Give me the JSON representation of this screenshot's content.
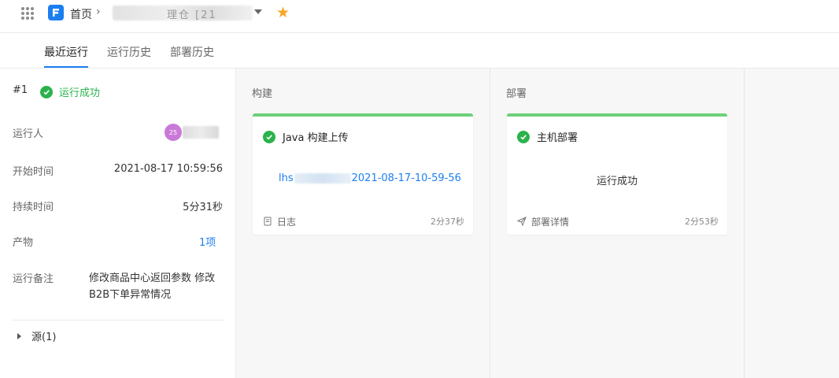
{
  "header": {
    "home_label": "首页",
    "project_name_visible": "理仓 [21",
    "favorite_icon": "star-icon"
  },
  "tabs": [
    {
      "label": "最近运行",
      "active": true
    },
    {
      "label": "运行历史",
      "active": false
    },
    {
      "label": "部署历史",
      "active": false
    }
  ],
  "run": {
    "number": "#1",
    "status": "运行成功",
    "runner_label": "运行人",
    "runner_avatar_text": "25",
    "start_label": "开始时间",
    "start_value": "2021-08-17 10:59:56",
    "duration_label": "持续时间",
    "duration_value": "5分31秒",
    "artifact_label": "产物",
    "artifact_value": "1项",
    "note_label": "运行备注",
    "note_value": "修改商品中心返回参数 修改B2B下单异常情况",
    "source_label": "源(1)"
  },
  "stages": [
    {
      "title": "构建",
      "card": {
        "title": "Java 构建上传",
        "link_prefix": "lhs",
        "link_suffix": "2021-08-17-10-59-56",
        "footer_label": "日志",
        "footer_icon": "log-icon",
        "duration": "2分37秒"
      }
    },
    {
      "title": "部署",
      "card": {
        "title": "主机部署",
        "body_text": "运行成功",
        "footer_label": "部署详情",
        "footer_icon": "send-icon",
        "duration": "2分53秒"
      }
    }
  ],
  "colors": {
    "accent": "#1b7ff0",
    "success": "#2bb24c",
    "stage_bar": "#6ed07a",
    "favorite": "#f5a623"
  }
}
